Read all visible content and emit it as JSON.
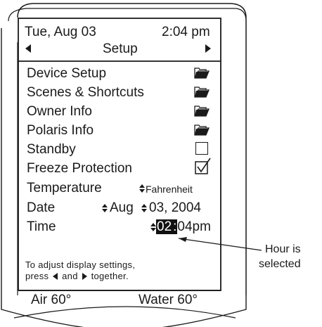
{
  "header": {
    "date": "Tue, Aug 03",
    "time": "2:04 pm",
    "title": "Setup"
  },
  "menu": {
    "items": [
      {
        "label": "Device Setup",
        "icon": "folder-icon"
      },
      {
        "label": "Scenes & Shortcuts",
        "icon": "folder-icon"
      },
      {
        "label": "Owner Info",
        "icon": "folder-icon"
      },
      {
        "label": "Polaris Info",
        "icon": "folder-icon"
      },
      {
        "label": "Standby",
        "icon": "checkbox-unchecked-icon",
        "checked": false
      },
      {
        "label": "Freeze Protection",
        "icon": "checkbox-checked-icon",
        "checked": true
      }
    ],
    "temperature": {
      "label": "Temperature",
      "value": "Fahrenheit"
    },
    "date": {
      "label": "Date",
      "month": "Aug",
      "day_year": "03, 2004"
    },
    "time": {
      "label": "Time",
      "hour": "02",
      "separator": ":",
      "rest": "04pm"
    }
  },
  "hint": {
    "line1": "To adjust display settings,",
    "line2_a": "press",
    "line2_b": "and",
    "line2_c": "together."
  },
  "footer": {
    "air": "Air  60°",
    "water": "Water  60°"
  },
  "callout": {
    "line1": "Hour is",
    "line2": "selected"
  },
  "colors": {
    "ink": "#1a1a1a",
    "highlight": "#111111",
    "background": "#ffffff"
  }
}
